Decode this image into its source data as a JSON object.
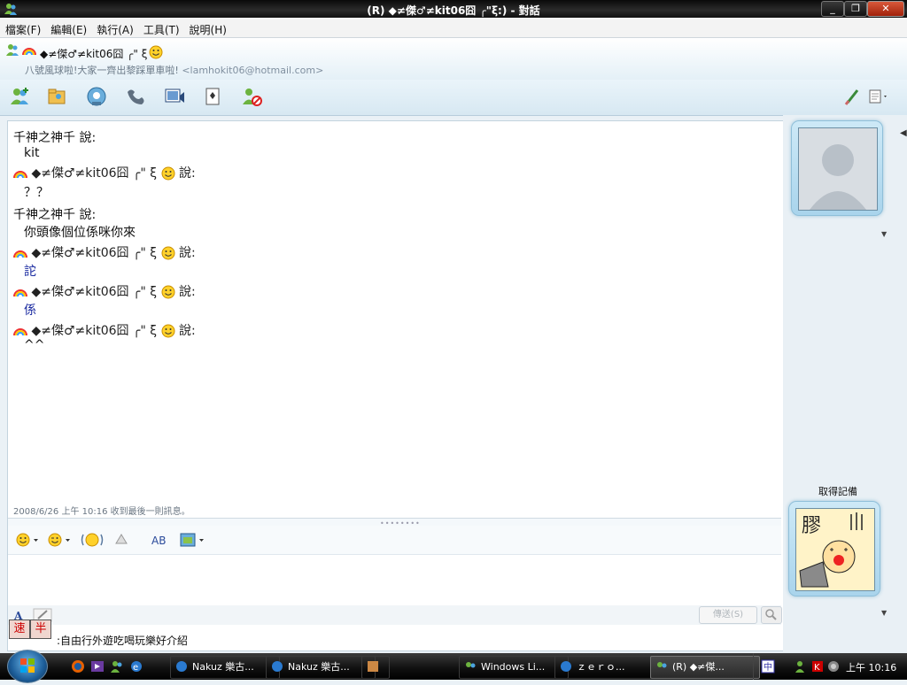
{
  "window": {
    "title": "(R) ◆≠傑♂≠kit06囧 ╭\"ξ:) - 對話",
    "controls": {
      "minimize": "_",
      "maximize": "❐",
      "close": "✕"
    }
  },
  "menubar": {
    "items": [
      "檔案(F)",
      "編輯(E)",
      "執行(A)",
      "工具(T)",
      "說明(H)"
    ]
  },
  "contact": {
    "name": "◆≠傑♂≠kit06囧 ╭\" ξ",
    "status_message": "八號風球啦!大家一齊出黎踩單車啦!",
    "email": "<lamhokit06@hotmail.com>"
  },
  "conversation": {
    "messages": [
      {
        "sender": "千神之神千 說:",
        "text": "kit"
      },
      {
        "sender": "◆≠傑♂≠kit06囧 ╭\" ξ",
        "says": "說:",
        "text": "？？"
      },
      {
        "sender": "千神之神千 說:",
        "text": "你頭像個位係咪你來"
      },
      {
        "sender": "◆≠傑♂≠kit06囧 ╭\" ξ",
        "says": "說:",
        "text": "詑"
      },
      {
        "sender": "◆≠傑♂≠kit06囧 ╭\" ξ",
        "says": "說:",
        "text": "係"
      },
      {
        "sender": "◆≠傑♂≠kit06囧 ╭\" ξ",
        "says": "說:",
        "text": "^^"
      }
    ],
    "last_message_info": "2008/6/26 上午 10:16 收到最後一則訊息。"
  },
  "input": {
    "send_label": "傳送(S)",
    "ime_chars": [
      "速",
      "半"
    ],
    "ime_status": ":自由行外遊吃喝玩樂好介紹"
  },
  "sidepanel": {
    "get_backup_label": "取得記備",
    "my_avatar_char": "膠"
  },
  "taskbar": {
    "tasks": [
      "Nakuz 樂古...",
      "Nakuz 樂古...",
      "Windows Li...",
      "ｚｅｒｏ...",
      "(R) ◆≠傑..."
    ],
    "clock": "上午 10:16"
  },
  "colors": {
    "accent_blue": "#1a2aa0",
    "titlebar_dark": "#111111",
    "panel_bg": "#e9f0f5"
  }
}
